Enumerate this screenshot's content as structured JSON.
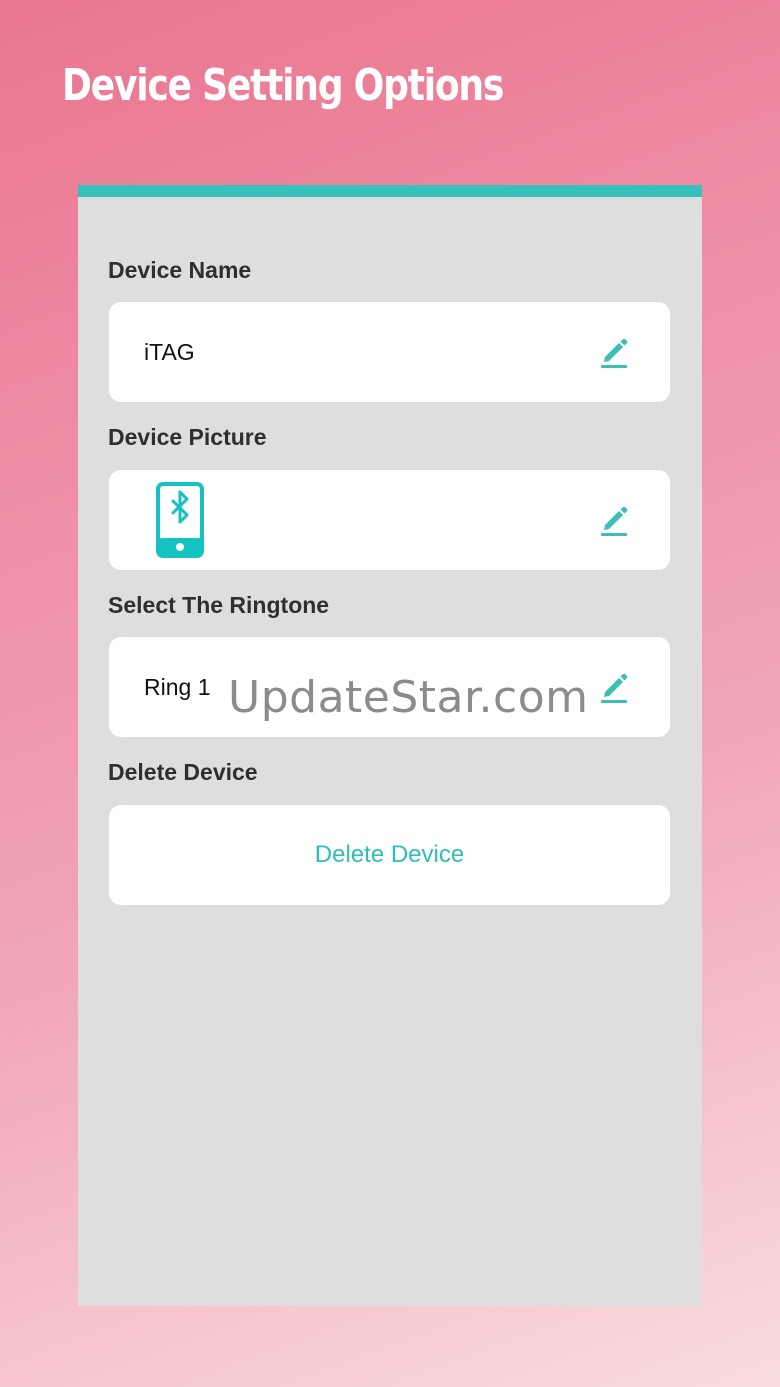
{
  "promo": {
    "title": "Device Setting Options"
  },
  "settings": {
    "device_name": {
      "label": "Device Name",
      "value": "iTAG"
    },
    "device_picture": {
      "label": "Device Picture",
      "icon": "phone-bluetooth-icon"
    },
    "ringtone": {
      "label": "Select The Ringtone",
      "value": "Ring 1"
    },
    "delete": {
      "label": "Delete Device",
      "button_label": "Delete Device"
    }
  },
  "watermark": "UpdateStar.com",
  "colors": {
    "accent": "#36c2bc",
    "card_background": "#dedede",
    "row_background": "#ffffff",
    "page_gradient_start": "#ea7590",
    "page_gradient_end": "#f8dcdc"
  }
}
